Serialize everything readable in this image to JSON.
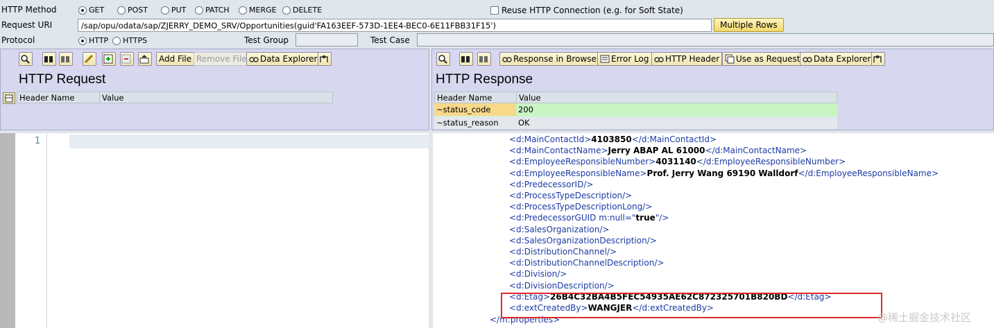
{
  "top": {
    "method_label": "HTTP Method",
    "methods": [
      "GET",
      "POST",
      "PUT",
      "PATCH",
      "MERGE",
      "DELETE"
    ],
    "selected_method": "GET",
    "reuse_label": "Reuse HTTP Connection (e.g. for Soft State)",
    "uri_label": "Request URI",
    "uri_value": "/sap/opu/odata/sap/ZJERRY_DEMO_SRV/Opportunities(guid'FA163EEF-573D-1EE4-BEC0-6E11FBB31F15')",
    "multiple_rows": "Multiple Rows",
    "protocol_label": "Protocol",
    "protocols": [
      "HTTP",
      "HTTPS"
    ],
    "selected_protocol": "HTTP",
    "test_group_label": "Test Group",
    "test_case_label": "Test Case"
  },
  "request": {
    "title": "HTTP Request",
    "add_file": "Add File",
    "remove_file": "Remove File",
    "data_explorer": "Data Explorer",
    "col_header_name": "Header Name",
    "col_value": "Value",
    "line_number": "1"
  },
  "response": {
    "title": "HTTP Response",
    "response_in_browser": "Response in Browser",
    "error_log": "Error Log",
    "http_header": "HTTP Header",
    "use_as_request": "Use as Request",
    "data_explorer": "Data Explorer",
    "col_header_name": "Header Name",
    "col_value": "Value",
    "rows": [
      {
        "name": "~status_code",
        "value": "200"
      },
      {
        "name": "~status_reason",
        "value": "OK"
      }
    ]
  },
  "xml_lines": [
    {
      "open": "<d:MainContactId>",
      "value": "4103850",
      "close": "</d:MainContactId>"
    },
    {
      "open": "<d:MainContactName>",
      "value": "Jerry ABAP AL 61000",
      "close": "</d:MainContactName>"
    },
    {
      "open": "<d:EmployeeResponsibleNumber>",
      "value": "4031140",
      "close": "</d:EmployeeResponsibleNumber>"
    },
    {
      "open": "<d:EmployeeResponsibleName>",
      "value": "Prof. Jerry Wang 69190 Walldorf",
      "close": "</d:EmployeeResponsibleName>"
    },
    {
      "open": "<d:PredecessorID/>",
      "value": "",
      "close": ""
    },
    {
      "open": "<d:ProcessTypeDescription/>",
      "value": "",
      "close": ""
    },
    {
      "open": "<d:ProcessTypeDescriptionLong/>",
      "value": "",
      "close": ""
    },
    {
      "open": "<d:PredecessorGUID m:null=\"",
      "value": "true",
      "close": "\"/>"
    },
    {
      "open": "<d:SalesOrganization/>",
      "value": "",
      "close": ""
    },
    {
      "open": "<d:SalesOrganizationDescription/>",
      "value": "",
      "close": ""
    },
    {
      "open": "<d:DistributionChannel/>",
      "value": "",
      "close": ""
    },
    {
      "open": "<d:DistributionChannelDescription/>",
      "value": "",
      "close": ""
    },
    {
      "open": "<d:Division/>",
      "value": "",
      "close": ""
    },
    {
      "open": "<d:DivisionDescription/>",
      "value": "",
      "close": ""
    },
    {
      "open": "<d:Etag>",
      "value": "26B4C32BA4B5FEC54935AE62C872325701B820BD",
      "close": "</d:Etag>"
    },
    {
      "open": "<d:extCreatedBy>",
      "value": "WANGJER",
      "close": "</d:extCreatedBy>"
    }
  ],
  "xml_last": "</m:properties>",
  "watermark": "@稀土掘金技术社区",
  "colors": {
    "highlight_box": "#e0282a",
    "status_row": "#c8f5c2",
    "status_cell": "#f7d98a"
  }
}
